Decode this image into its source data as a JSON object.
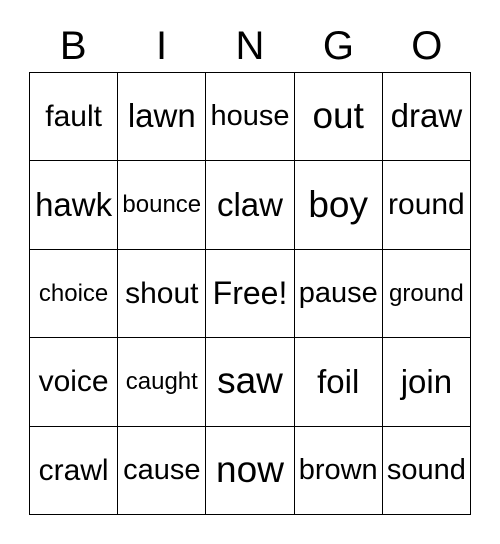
{
  "card": {
    "header": {
      "letters": [
        "B",
        "I",
        "N",
        "G",
        "O"
      ]
    },
    "rows": [
      {
        "cells": [
          {
            "text": "fault"
          },
          {
            "text": "lawn"
          },
          {
            "text": "house"
          },
          {
            "text": "out"
          },
          {
            "text": "draw"
          }
        ]
      },
      {
        "cells": [
          {
            "text": "hawk"
          },
          {
            "text": "bounce"
          },
          {
            "text": "claw"
          },
          {
            "text": "boy"
          },
          {
            "text": "round"
          }
        ]
      },
      {
        "cells": [
          {
            "text": "choice"
          },
          {
            "text": "shout"
          },
          {
            "text": "Free!"
          },
          {
            "text": "pause"
          },
          {
            "text": "ground"
          }
        ]
      },
      {
        "cells": [
          {
            "text": "voice"
          },
          {
            "text": "caught"
          },
          {
            "text": "saw"
          },
          {
            "text": "foil"
          },
          {
            "text": "join"
          }
        ]
      },
      {
        "cells": [
          {
            "text": "crawl"
          },
          {
            "text": "cause"
          },
          {
            "text": "now"
          },
          {
            "text": "brown"
          },
          {
            "text": "sound"
          }
        ]
      }
    ],
    "colors": {
      "text": "#000000",
      "border": "#000000",
      "cell_background": "#ffffff",
      "page_background": "#ffffff"
    }
  }
}
